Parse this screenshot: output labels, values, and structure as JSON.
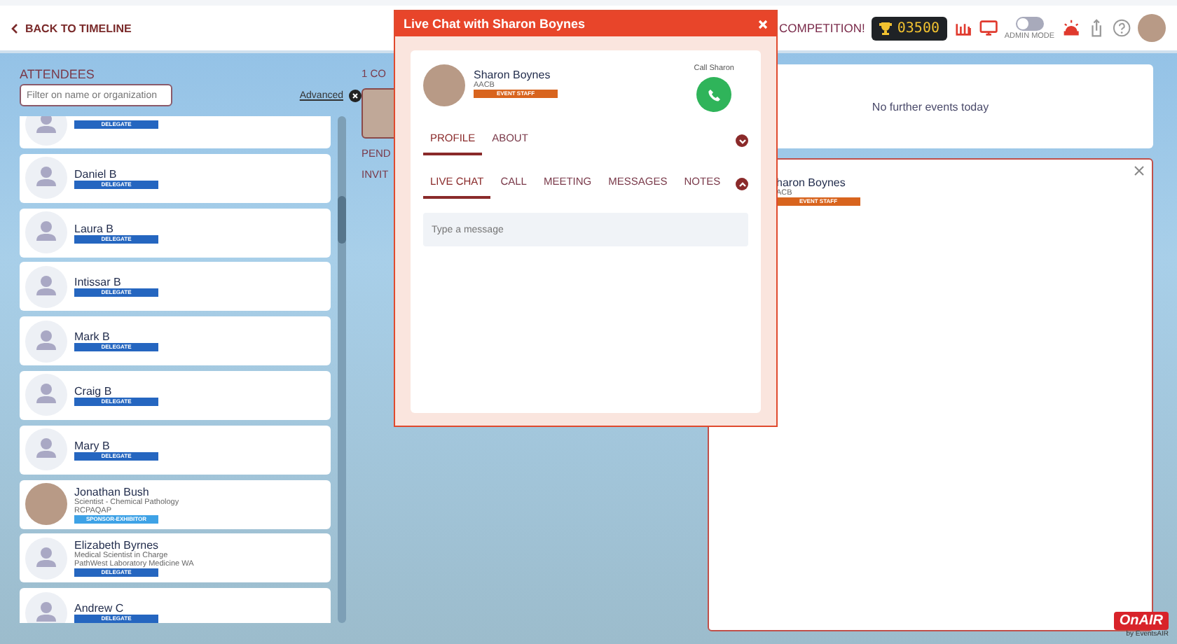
{
  "top_bar": {
    "back_link": "BACK TO TIMELINE",
    "competition": "COMPETITION!",
    "score": "03500",
    "admin_mode": {
      "label": "ADMIN MODE",
      "on": false
    }
  },
  "attendees": {
    "title": "ATTENDEES",
    "filter": {
      "placeholder": "Filter on name or organization"
    },
    "advanced_link": "Advanced",
    "items": [
      {
        "badge": "DELEGATE",
        "kind": "delegate",
        "has_photo": false
      },
      {
        "name": "Daniel B",
        "badge": "DELEGATE",
        "kind": "delegate",
        "has_photo": false
      },
      {
        "name": "Laura B",
        "badge": "DELEGATE",
        "kind": "delegate",
        "has_photo": false
      },
      {
        "name": "Intissar B",
        "badge": "DELEGATE",
        "kind": "delegate",
        "has_photo": false
      },
      {
        "name": "Mark B",
        "badge": "DELEGATE",
        "kind": "delegate",
        "has_photo": false
      },
      {
        "name": "Craig B",
        "badge": "DELEGATE",
        "kind": "delegate",
        "has_photo": false
      },
      {
        "name": "Mary B",
        "badge": "DELEGATE",
        "kind": "delegate",
        "has_photo": false
      },
      {
        "name": "Jonathan Bush",
        "title": "Scientist - Chemical Pathology",
        "organization": "RCPAQAP",
        "badge": "SPONSOR-EXHIBITOR",
        "kind": "sponsor",
        "has_photo": true
      },
      {
        "name": "Elizabeth Byrnes",
        "title": "Medical Scientist in Charge",
        "organization": "PathWest Laboratory Medicine WA",
        "badge": "DELEGATE",
        "kind": "delegate",
        "has_photo": false
      },
      {
        "name": "Andrew C",
        "badge": "DELEGATE",
        "kind": "delegate",
        "has_photo": false
      }
    ]
  },
  "connections": {
    "heading": "1 CO",
    "pending": "PEND",
    "invited": "INVIT"
  },
  "events_card": {
    "message": "No further events today"
  },
  "contact_card": {
    "name": "haron Boynes",
    "organization": "ACB",
    "badge": "EVENT STAFF"
  },
  "chat_window": {
    "title": "Live Chat with Sharon Boynes",
    "contact": {
      "name": "Sharon Boynes",
      "organization": "AACB",
      "badge": "EVENT STAFF"
    },
    "call_label": "Call Sharon",
    "profile_tabs": [
      {
        "label": "PROFILE",
        "selected": true
      },
      {
        "label": "ABOUT",
        "selected": false
      }
    ],
    "chat_tabs": [
      {
        "label": "LIVE CHAT",
        "selected": true
      },
      {
        "label": "CALL",
        "selected": false
      },
      {
        "label": "MEETING",
        "selected": false
      },
      {
        "label": "MESSAGES",
        "selected": false
      },
      {
        "label": "NOTES",
        "selected": false
      }
    ],
    "message": {
      "placeholder": "Type a message"
    }
  },
  "brand": {
    "logo": "OnAIR",
    "byline": "by EventsAIR"
  }
}
